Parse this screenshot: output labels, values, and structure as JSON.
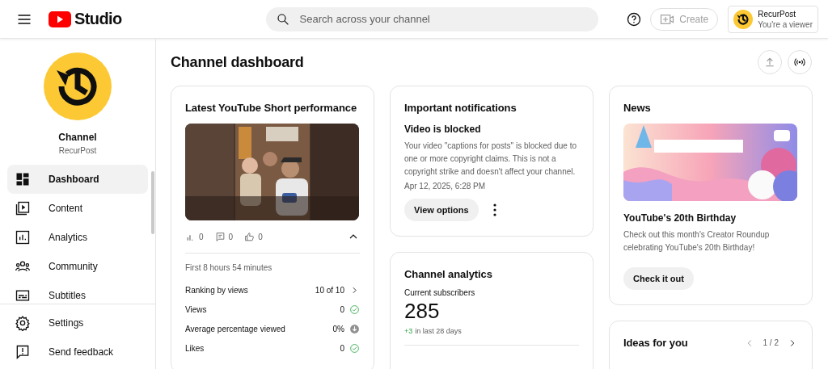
{
  "topbar": {
    "logo_text": "Studio",
    "search": {
      "placeholder": "Search across your channel"
    },
    "create": {
      "label": "Create",
      "disabled": true
    },
    "account": {
      "name": "RecurPost",
      "role": "You're a viewer"
    }
  },
  "sidebar": {
    "channel_label": "Channel",
    "channel_name": "RecurPost",
    "items": [
      {
        "label": "Dashboard",
        "kind": "dashboard",
        "selected": true
      },
      {
        "label": "Content",
        "kind": "content",
        "selected": false
      },
      {
        "label": "Analytics",
        "kind": "analytics",
        "selected": false
      },
      {
        "label": "Community",
        "kind": "community",
        "selected": false
      },
      {
        "label": "Subtitles",
        "kind": "subtitles",
        "selected": false
      }
    ],
    "footer_items": [
      {
        "label": "Settings",
        "kind": "settings"
      },
      {
        "label": "Send feedback",
        "kind": "feedback"
      }
    ]
  },
  "page": {
    "title": "Channel dashboard"
  },
  "short_card": {
    "title": "Latest YouTube Short performance",
    "stats": [
      {
        "kind": "views",
        "value": "0"
      },
      {
        "kind": "comments",
        "value": "0"
      },
      {
        "kind": "likes",
        "value": "0"
      }
    ],
    "expanded": true,
    "period": "First 8 hours 54 minutes",
    "metrics": [
      {
        "label": "Ranking by views",
        "value": "10 of 10",
        "kind": "link"
      },
      {
        "label": "Views",
        "value": "0",
        "kind": "ok"
      },
      {
        "label": "Average percentage viewed",
        "value": "0%",
        "kind": "down"
      },
      {
        "label": "Likes",
        "value": "0",
        "kind": "ok"
      }
    ]
  },
  "notifications_card": {
    "title": "Important notifications",
    "headline": "Video is blocked",
    "body": "Your video \"captions for posts\" is blocked due to one or more copyright claims. This is not a copyright strike and doesn't affect your channel.",
    "date": "Apr 12, 2025, 6:28 PM",
    "button": "View options"
  },
  "analytics_card": {
    "title": "Channel analytics",
    "subscribers_label": "Current subscribers",
    "subscribers": "285",
    "change": "+3",
    "change_suffix": "in last 28 days"
  },
  "news_card": {
    "title": "News",
    "headline": "YouTube's 20th Birthday",
    "body": "Check out this month's Creator Roundup celebrating YouTube's 20th Birthday!",
    "button": "Check it out"
  },
  "ideas_card": {
    "title": "Ideas for you",
    "pager": "1 / 2"
  }
}
